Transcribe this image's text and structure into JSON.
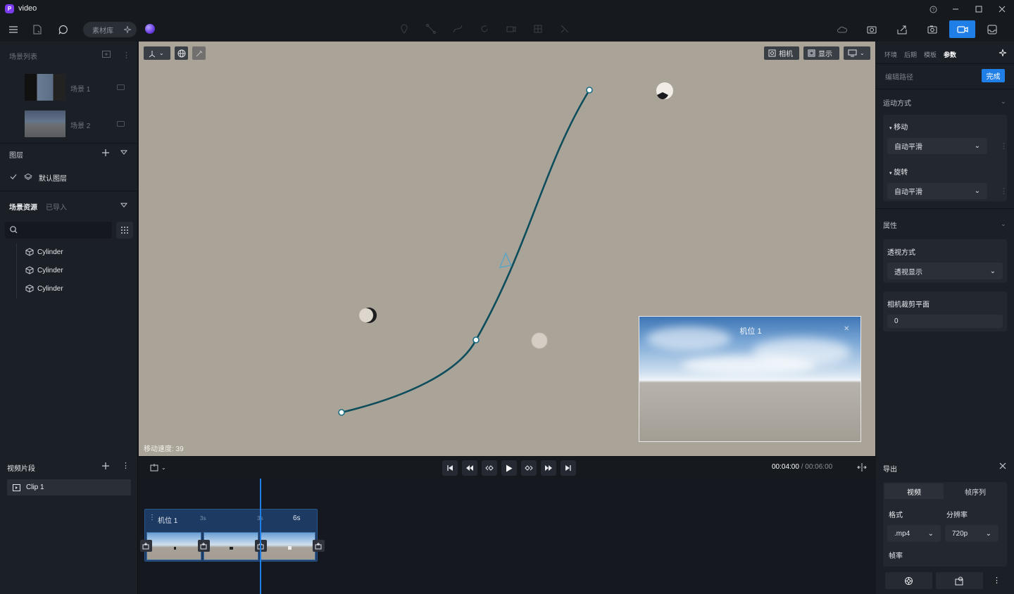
{
  "app": {
    "title": "video"
  },
  "toolbar": {
    "asset_btn": "素材库"
  },
  "left": {
    "scene_list_title": "场景列表",
    "scenes": [
      {
        "label": "场景 1"
      },
      {
        "label": "场景 2"
      }
    ],
    "layers_title": "图层",
    "default_layer": "默认图层",
    "resources_tab": "场景资源",
    "imported_tab": "已导入",
    "search_placeholder": "",
    "objects": [
      {
        "label": "Cylinder"
      },
      {
        "label": "Cylinder"
      },
      {
        "label": "Cylinder"
      }
    ]
  },
  "viewport": {
    "camera_btn": "相机",
    "display_btn": "显示",
    "move_speed": "移动速度: 39",
    "preview_label": "机位 1"
  },
  "right": {
    "tabs": [
      "环境",
      "后期",
      "模板",
      "参数"
    ],
    "active_tab": "参数",
    "edit_path": "编辑路径",
    "done_btn": "完成",
    "motion_title": "运动方式",
    "move_label": "移动",
    "move_value": "自动平滑",
    "rotate_label": "旋转",
    "rotate_value": "自动平滑",
    "props_title": "属性",
    "perspective_label": "透视方式",
    "perspective_value": "透视显示",
    "clip_label": "相机裁剪平面",
    "clip_value": "0"
  },
  "clips": {
    "title": "视频片段",
    "items": [
      {
        "label": "Clip 1"
      }
    ]
  },
  "timeline": {
    "time_current": "00:04:00",
    "time_sep": " / ",
    "time_total": "00:06:00",
    "track_label": "机位 1",
    "marker_3s_a": "3s",
    "marker_3s_b": "3s",
    "marker_6s": "6s"
  },
  "export": {
    "title": "导出",
    "tab_video": "视频",
    "tab_seq": "帧序列",
    "format_label": "格式",
    "format_value": ".mp4",
    "res_label": "分辨率",
    "res_value": "720p",
    "fps_label": "帧率"
  },
  "colors": {
    "accent": "#1f7fe6",
    "path": "#0e4d5c",
    "viewport": "#aaa398"
  }
}
